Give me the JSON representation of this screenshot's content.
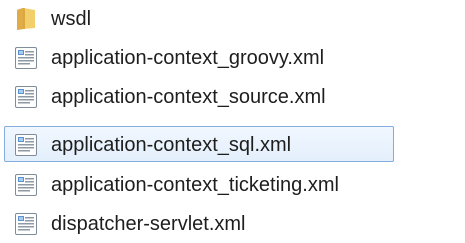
{
  "files": [
    {
      "label": "wsdl",
      "icon": "folder-icon",
      "selected": false
    },
    {
      "label": "application-context_groovy.xml",
      "icon": "xml-file-icon",
      "selected": false
    },
    {
      "label": "application-context_source.xml",
      "icon": "xml-file-icon",
      "selected": false
    },
    {
      "label": "application-context_sql.xml",
      "icon": "xml-file-icon",
      "selected": true
    },
    {
      "label": "application-context_ticketing.xml",
      "icon": "xml-file-icon",
      "selected": false
    },
    {
      "label": "dispatcher-servlet.xml",
      "icon": "xml-file-icon",
      "selected": false
    }
  ],
  "colors": {
    "selection_border": "#84acdd",
    "selection_fill": "#e3effc",
    "folder": "#e8b84a",
    "text": "#1e1e1e"
  }
}
